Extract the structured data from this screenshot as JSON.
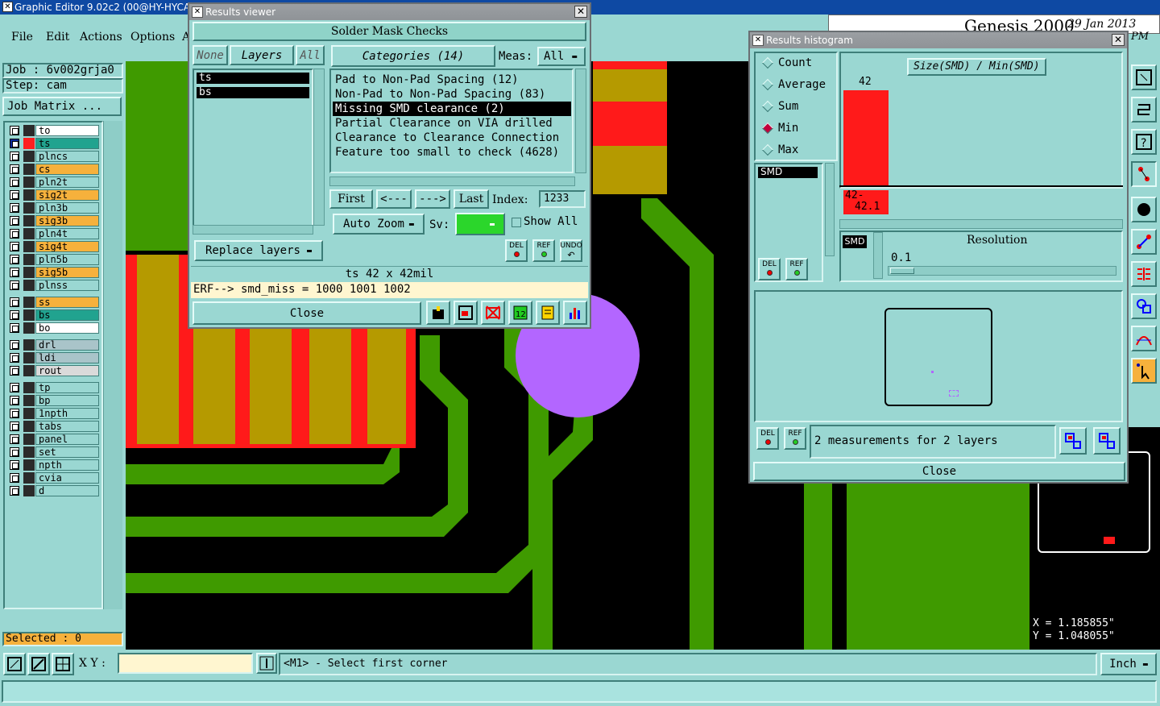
{
  "window": {
    "title": "Graphic Editor 9.02c2 (00@HY-HYCAM"
  },
  "menu": [
    "File",
    "Edit",
    "Actions",
    "Options",
    "A"
  ],
  "header_right": {
    "brand": "Genesis 2000",
    "date": "29 Jan 2013",
    "ampm": "PM"
  },
  "job": {
    "job_label": "Job : 6v002grja0",
    "step_label": "Step: cam",
    "matrix_button": "Job Matrix ..."
  },
  "layers": [
    {
      "name": "to",
      "color": "#ffffff",
      "sel": false,
      "mark": ""
    },
    {
      "name": "ts",
      "color": "#21a38f",
      "sel": true,
      "mark": "▪"
    },
    {
      "name": "plncs",
      "color": "#9ad7d2",
      "sel": false,
      "mark": ""
    },
    {
      "name": "cs",
      "color": "#f6b13c",
      "sel": false,
      "mark": "⬋"
    },
    {
      "name": "pln2t",
      "color": "#9ad7d2",
      "sel": false,
      "mark": ""
    },
    {
      "name": "sig2t",
      "color": "#f6b13c",
      "sel": false,
      "mark": ""
    },
    {
      "name": "pln3b",
      "color": "#9ad7d2",
      "sel": false,
      "mark": ""
    },
    {
      "name": "sig3b",
      "color": "#f6b13c",
      "sel": false,
      "mark": ""
    },
    {
      "name": "pln4t",
      "color": "#9ad7d2",
      "sel": false,
      "mark": ""
    },
    {
      "name": "sig4t",
      "color": "#f6b13c",
      "sel": false,
      "mark": ""
    },
    {
      "name": "pln5b",
      "color": "#9ad7d2",
      "sel": false,
      "mark": ""
    },
    {
      "name": "sig5b",
      "color": "#f6b13c",
      "sel": false,
      "mark": ""
    },
    {
      "name": "plnss",
      "color": "#9ad7d2",
      "sel": false,
      "mark": ""
    },
    {
      "name": "ss",
      "color": "#f6b13c",
      "sel": false,
      "mark": "⬋"
    },
    {
      "name": "bs",
      "color": "#21a38f",
      "sel": false,
      "mark": ""
    },
    {
      "name": "bo",
      "color": "#ffffff",
      "sel": false,
      "mark": ""
    },
    {
      "name": "drl",
      "color": "#a9c4c9",
      "sel": false,
      "mark": ""
    },
    {
      "name": "ldi",
      "color": "#a9c4c9",
      "sel": false,
      "mark": ""
    },
    {
      "name": "rout",
      "color": "#dadada",
      "sel": false,
      "mark": ""
    },
    {
      "name": "tp",
      "color": "#9ad7d2",
      "sel": false,
      "mark": ""
    },
    {
      "name": "bp",
      "color": "#9ad7d2",
      "sel": false,
      "mark": ""
    },
    {
      "name": "1npth",
      "color": "#9ad7d2",
      "sel": false,
      "mark": ""
    },
    {
      "name": "tabs",
      "color": "#9ad7d2",
      "sel": false,
      "mark": ""
    },
    {
      "name": "panel",
      "color": "#9ad7d2",
      "sel": false,
      "mark": "⬋"
    },
    {
      "name": "set",
      "color": "#9ad7d2",
      "sel": false,
      "mark": ""
    },
    {
      "name": "npth",
      "color": "#9ad7d2",
      "sel": false,
      "mark": ""
    },
    {
      "name": "cvia",
      "color": "#9ad7d2",
      "sel": false,
      "mark": ""
    },
    {
      "name": "d",
      "color": "#9ad7d2",
      "sel": false,
      "mark": ""
    }
  ],
  "status": {
    "selected": "Selected : 0",
    "xy_label": "X Y :",
    "xy_value": "",
    "prompt": "<M1> - Select first corner",
    "units": "Inch",
    "coord_x": "X = 1.185855\"",
    "coord_y": "Y = 1.048055\""
  },
  "results_viewer": {
    "title": "Results viewer",
    "heading": "Solder Mask Checks",
    "none_btn": "None",
    "layers_btn": "Layers",
    "all_btn": "All",
    "layer_list": [
      "ts",
      "bs"
    ],
    "categories_btn": "Categories (14)",
    "meas_label": "Meas:",
    "meas_value": "All",
    "categories": [
      "Pad to Non-Pad Spacing (12)",
      "Non-Pad to Non-Pad Spacing (83)",
      "Missing SMD clearance (2)",
      "Partial Clearance on VIA drilled",
      "Clearance to Clearance Connection",
      "Feature too small to check (4628)"
    ],
    "selected_category": 2,
    "first_btn": "First",
    "prev_btn": "<---",
    "next_btn": "--->",
    "last_btn": "Last",
    "index_label": "Index:",
    "index_value": "1233",
    "auto_zoom": "Auto Zoom",
    "sv_label": "Sv:",
    "show_all": "Show All",
    "replace_layers": "Replace layers",
    "del": "DEL",
    "ref": "REF",
    "undo": "UNDO",
    "info": "ts 42 x 42mil",
    "erf": "ERF--> smd_miss = 1000 1001 1002",
    "close": "Close",
    "tool_12": "12"
  },
  "histogram": {
    "title": "Results histogram",
    "options": [
      "Count",
      "Average",
      "Sum",
      "Min",
      "Max"
    ],
    "selected_option": "Min",
    "formula": "Size(SMD) / Min(SMD)",
    "bar_label": "42",
    "range_label_1": "42-",
    "range_label_2": "42.1",
    "list": [
      "SMD"
    ],
    "tag": "SMD",
    "resolution_label": "Resolution",
    "resolution_value": "0.1",
    "del": "DEL",
    "ref": "REF",
    "summary": "2 measurements for 2 layers",
    "close": "Close",
    "accent": "#ff1a1a"
  },
  "colors": {
    "pcb_bg": "#000000",
    "trace": "#3f9a00",
    "pad": "#ff1a1a",
    "overlap": "#b59a00",
    "mask": "#21a38f",
    "via": "#b366ff",
    "panel": "#9ad7d2"
  }
}
